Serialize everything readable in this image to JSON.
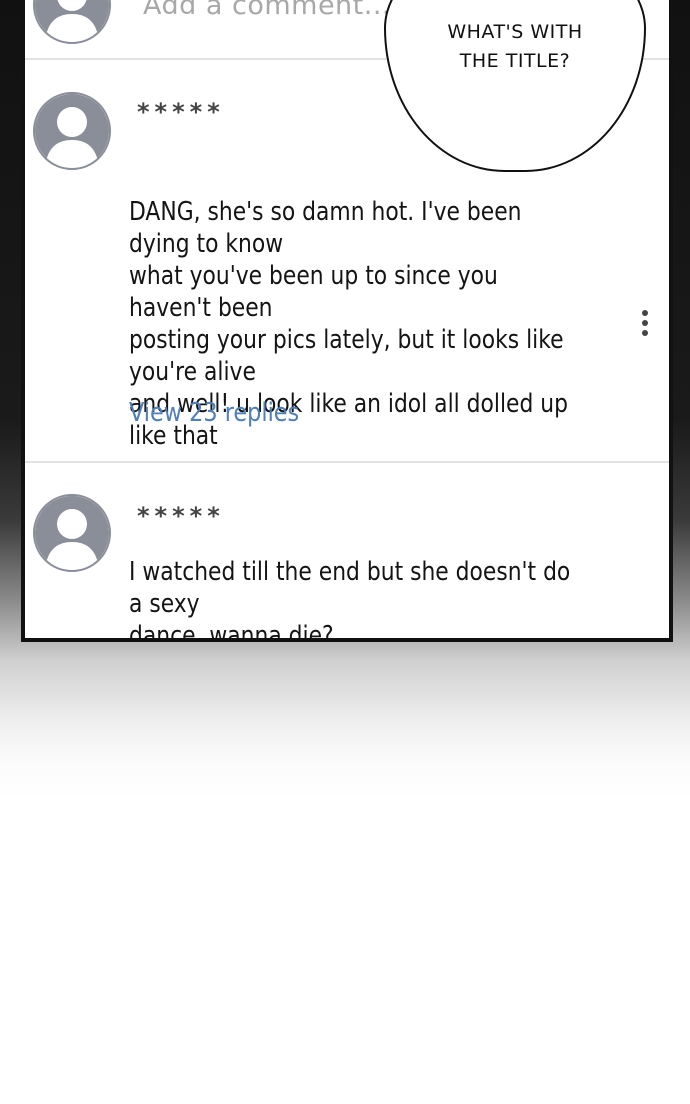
{
  "top": {
    "add_comment_placeholder": "Add a comment..."
  },
  "speech_bubble": {
    "line1": "WHAT'S WITH",
    "line2": "THE TITLE?"
  },
  "comments": [
    {
      "username": "*****",
      "text": "DANG, she's so damn hot. I've been dying to know\nwhat you've been up to since you haven't been\nposting your pics lately, but it looks like you're alive\nand well! u look like an idol all dolled up like that",
      "replies_label": "View 23 replies"
    },
    {
      "username": "*****",
      "text": "I watched till the end but she doesn't do a sexy\ndance. wanna die?"
    }
  ],
  "colors": {
    "link": "#4f7fb8",
    "avatar": "#8a8e99",
    "placeholder": "#a8a8a8"
  }
}
